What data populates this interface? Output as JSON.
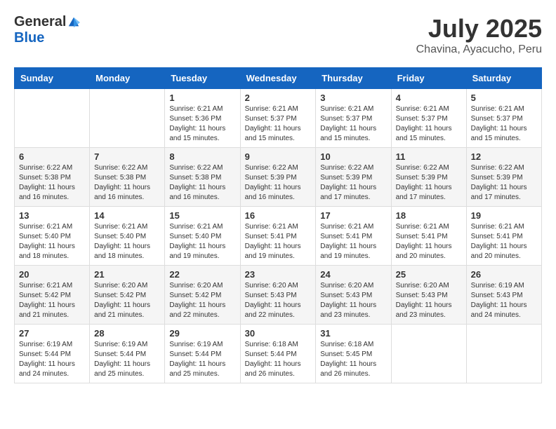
{
  "header": {
    "logo_general": "General",
    "logo_blue": "Blue",
    "month": "July 2025",
    "location": "Chavina, Ayacucho, Peru"
  },
  "days_of_week": [
    "Sunday",
    "Monday",
    "Tuesday",
    "Wednesday",
    "Thursday",
    "Friday",
    "Saturday"
  ],
  "weeks": [
    [
      {
        "day": "",
        "details": ""
      },
      {
        "day": "",
        "details": ""
      },
      {
        "day": "1",
        "details": "Sunrise: 6:21 AM\nSunset: 5:36 PM\nDaylight: 11 hours and 15 minutes."
      },
      {
        "day": "2",
        "details": "Sunrise: 6:21 AM\nSunset: 5:37 PM\nDaylight: 11 hours and 15 minutes."
      },
      {
        "day": "3",
        "details": "Sunrise: 6:21 AM\nSunset: 5:37 PM\nDaylight: 11 hours and 15 minutes."
      },
      {
        "day": "4",
        "details": "Sunrise: 6:21 AM\nSunset: 5:37 PM\nDaylight: 11 hours and 15 minutes."
      },
      {
        "day": "5",
        "details": "Sunrise: 6:21 AM\nSunset: 5:37 PM\nDaylight: 11 hours and 15 minutes."
      }
    ],
    [
      {
        "day": "6",
        "details": "Sunrise: 6:22 AM\nSunset: 5:38 PM\nDaylight: 11 hours and 16 minutes."
      },
      {
        "day": "7",
        "details": "Sunrise: 6:22 AM\nSunset: 5:38 PM\nDaylight: 11 hours and 16 minutes."
      },
      {
        "day": "8",
        "details": "Sunrise: 6:22 AM\nSunset: 5:38 PM\nDaylight: 11 hours and 16 minutes."
      },
      {
        "day": "9",
        "details": "Sunrise: 6:22 AM\nSunset: 5:39 PM\nDaylight: 11 hours and 16 minutes."
      },
      {
        "day": "10",
        "details": "Sunrise: 6:22 AM\nSunset: 5:39 PM\nDaylight: 11 hours and 17 minutes."
      },
      {
        "day": "11",
        "details": "Sunrise: 6:22 AM\nSunset: 5:39 PM\nDaylight: 11 hours and 17 minutes."
      },
      {
        "day": "12",
        "details": "Sunrise: 6:22 AM\nSunset: 5:39 PM\nDaylight: 11 hours and 17 minutes."
      }
    ],
    [
      {
        "day": "13",
        "details": "Sunrise: 6:21 AM\nSunset: 5:40 PM\nDaylight: 11 hours and 18 minutes."
      },
      {
        "day": "14",
        "details": "Sunrise: 6:21 AM\nSunset: 5:40 PM\nDaylight: 11 hours and 18 minutes."
      },
      {
        "day": "15",
        "details": "Sunrise: 6:21 AM\nSunset: 5:40 PM\nDaylight: 11 hours and 19 minutes."
      },
      {
        "day": "16",
        "details": "Sunrise: 6:21 AM\nSunset: 5:41 PM\nDaylight: 11 hours and 19 minutes."
      },
      {
        "day": "17",
        "details": "Sunrise: 6:21 AM\nSunset: 5:41 PM\nDaylight: 11 hours and 19 minutes."
      },
      {
        "day": "18",
        "details": "Sunrise: 6:21 AM\nSunset: 5:41 PM\nDaylight: 11 hours and 20 minutes."
      },
      {
        "day": "19",
        "details": "Sunrise: 6:21 AM\nSunset: 5:41 PM\nDaylight: 11 hours and 20 minutes."
      }
    ],
    [
      {
        "day": "20",
        "details": "Sunrise: 6:21 AM\nSunset: 5:42 PM\nDaylight: 11 hours and 21 minutes."
      },
      {
        "day": "21",
        "details": "Sunrise: 6:20 AM\nSunset: 5:42 PM\nDaylight: 11 hours and 21 minutes."
      },
      {
        "day": "22",
        "details": "Sunrise: 6:20 AM\nSunset: 5:42 PM\nDaylight: 11 hours and 22 minutes."
      },
      {
        "day": "23",
        "details": "Sunrise: 6:20 AM\nSunset: 5:43 PM\nDaylight: 11 hours and 22 minutes."
      },
      {
        "day": "24",
        "details": "Sunrise: 6:20 AM\nSunset: 5:43 PM\nDaylight: 11 hours and 23 minutes."
      },
      {
        "day": "25",
        "details": "Sunrise: 6:20 AM\nSunset: 5:43 PM\nDaylight: 11 hours and 23 minutes."
      },
      {
        "day": "26",
        "details": "Sunrise: 6:19 AM\nSunset: 5:43 PM\nDaylight: 11 hours and 24 minutes."
      }
    ],
    [
      {
        "day": "27",
        "details": "Sunrise: 6:19 AM\nSunset: 5:44 PM\nDaylight: 11 hours and 24 minutes."
      },
      {
        "day": "28",
        "details": "Sunrise: 6:19 AM\nSunset: 5:44 PM\nDaylight: 11 hours and 25 minutes."
      },
      {
        "day": "29",
        "details": "Sunrise: 6:19 AM\nSunset: 5:44 PM\nDaylight: 11 hours and 25 minutes."
      },
      {
        "day": "30",
        "details": "Sunrise: 6:18 AM\nSunset: 5:44 PM\nDaylight: 11 hours and 26 minutes."
      },
      {
        "day": "31",
        "details": "Sunrise: 6:18 AM\nSunset: 5:45 PM\nDaylight: 11 hours and 26 minutes."
      },
      {
        "day": "",
        "details": ""
      },
      {
        "day": "",
        "details": ""
      }
    ]
  ]
}
